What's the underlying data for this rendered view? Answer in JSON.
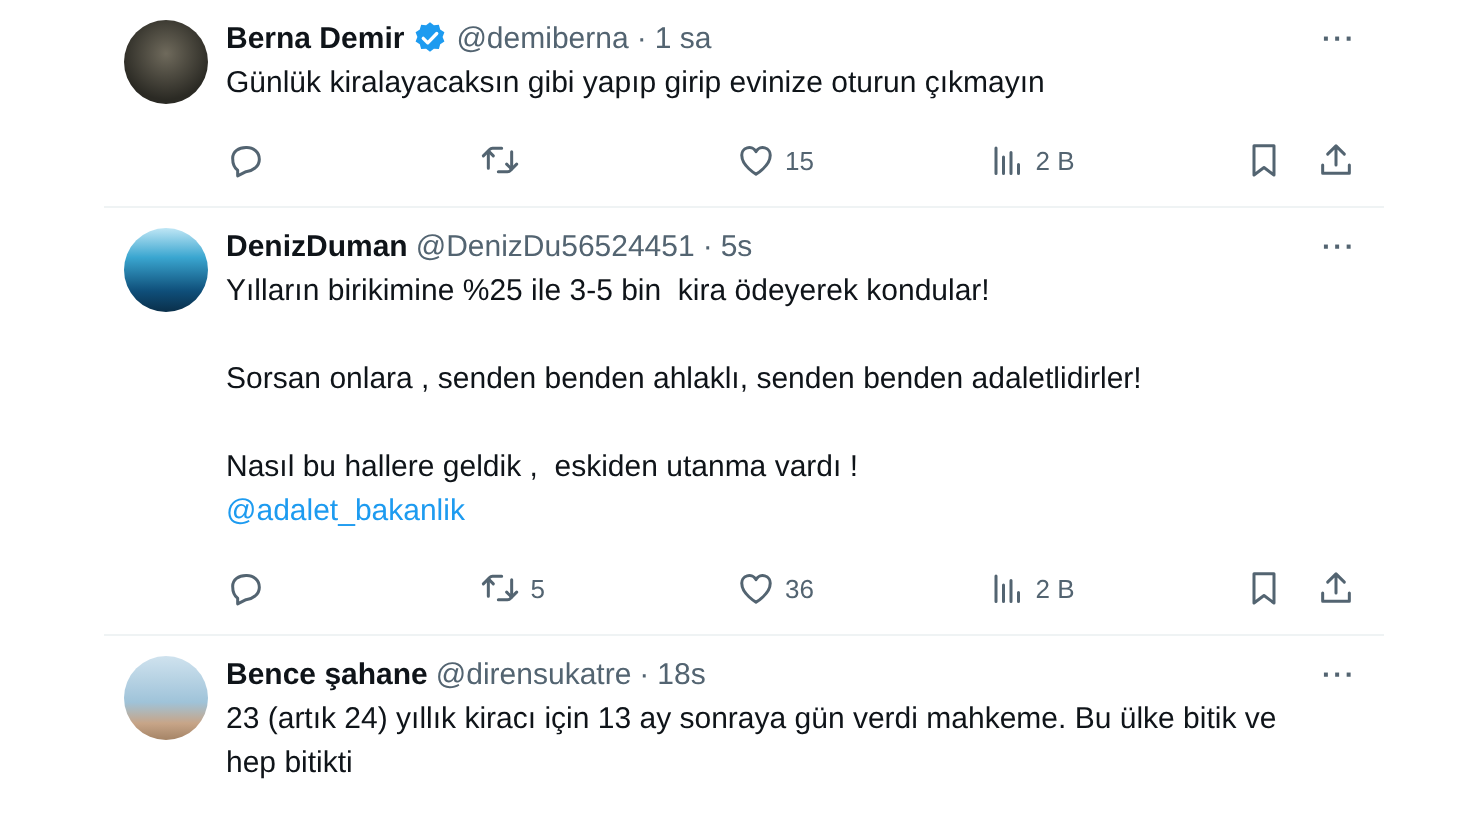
{
  "tweets": [
    {
      "name": "Berna Demir",
      "verified": true,
      "handle": "@demiberna",
      "dot": "·",
      "time": "1 sa",
      "more": "···",
      "paragraphs": [
        [
          {
            "kind": "text",
            "text": "Günlük kiralayacaksın gibi yapıp girip evinize oturun çıkmayın"
          }
        ]
      ],
      "actions": {
        "likes": "15",
        "views": "2 B"
      }
    },
    {
      "name": "DenizDuman",
      "verified": false,
      "handle": "@DenizDu56524451",
      "dot": "·",
      "time": "5s",
      "more": "···",
      "paragraphs": [
        [
          {
            "kind": "text",
            "text": "Yılların birikimine %25 ile 3-5 bin  kira ödeyerek kondular!"
          }
        ],
        [
          {
            "kind": "text",
            "text": "Sorsan onlara , senden benden ahlaklı, senden benden adaletlidirler!"
          }
        ],
        [
          {
            "kind": "text",
            "text": "Nasıl bu hallere geldik ,  eskiden utanma vardı !"
          },
          {
            "kind": "mention",
            "text": "@adalet_bakanlik"
          }
        ]
      ],
      "actions": {
        "retweets": "5",
        "likes": "36",
        "views": "2 B"
      }
    },
    {
      "name": "Bence şahane",
      "verified": false,
      "handle": "@dirensukatre",
      "dot": "·",
      "time": "18s",
      "more": "···",
      "paragraphs": [
        [
          {
            "kind": "text",
            "text": "23 (artık 24) yıllık kiracı için 13 ay sonraya gün verdi mahkeme. Bu ülke bitik ve hep bitikti"
          }
        ]
      ]
    }
  ]
}
